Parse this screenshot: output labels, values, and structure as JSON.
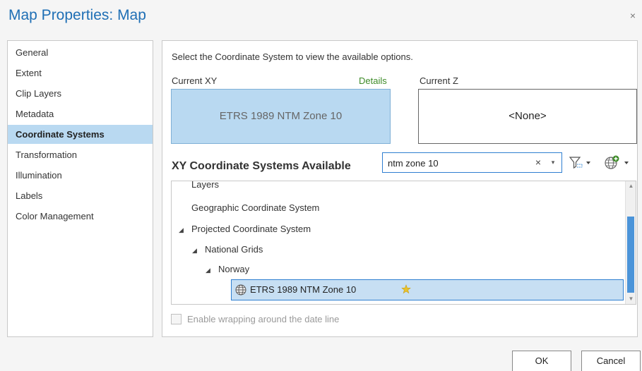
{
  "dialog": {
    "title": "Map Properties: Map",
    "close_glyph": "×"
  },
  "nav": {
    "items": [
      {
        "label": "General",
        "active": false
      },
      {
        "label": "Extent",
        "active": false
      },
      {
        "label": "Clip Layers",
        "active": false
      },
      {
        "label": "Metadata",
        "active": false
      },
      {
        "label": "Coordinate Systems",
        "active": true
      },
      {
        "label": "Transformation",
        "active": false
      },
      {
        "label": "Illumination",
        "active": false
      },
      {
        "label": "Labels",
        "active": false
      },
      {
        "label": "Color Management",
        "active": false
      }
    ]
  },
  "coord": {
    "instruction": "Select the Coordinate System to view the available options.",
    "current_xy_label": "Current XY",
    "details_label": "Details",
    "current_z_label": "Current Z",
    "current_xy_value": "ETRS 1989 NTM Zone 10",
    "current_z_value": "<None>",
    "available_heading": "XY Coordinate Systems Available",
    "search_value": "ntm zone 10",
    "search_clear_glyph": "×",
    "search_dropdown_glyph": "▾"
  },
  "tree": {
    "rows": [
      {
        "label": "Layers",
        "expanded": null
      },
      {
        "label": "Geographic Coordinate System",
        "expanded": null
      },
      {
        "label": "Projected Coordinate System",
        "expanded": true
      },
      {
        "label": "National Grids",
        "expanded": true
      },
      {
        "label": "Norway",
        "expanded": true
      }
    ],
    "selected": {
      "label": "ETRS 1989 NTM Zone 10",
      "icon": "globe-icon",
      "favorite_icon": "star-icon"
    },
    "expand_glyph": "◢"
  },
  "options": {
    "wrap_label": "Enable wrapping around the date line",
    "wrap_checked": false,
    "wrap_enabled": false
  },
  "buttons": {
    "ok": "OK",
    "cancel": "Cancel"
  },
  "colors": {
    "accent": "#1f6fb5",
    "selection": "#b9d9f1",
    "details_link": "#3d8b28",
    "scroll_thumb": "#4b94d9"
  }
}
